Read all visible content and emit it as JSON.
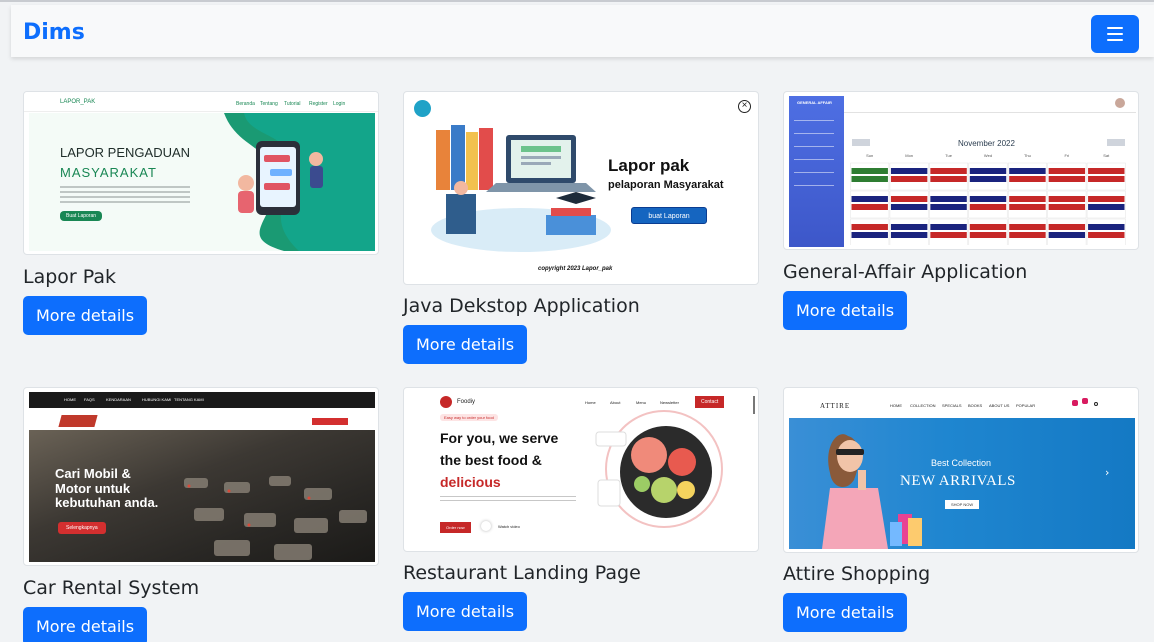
{
  "navbar": {
    "brand": "Dims",
    "menu_icon": "hamburger-icon"
  },
  "colors": {
    "primary": "#0d6efd",
    "page_bg": "#f1f3f5"
  },
  "projects": [
    {
      "title": "Lapor Pak",
      "button": "More details",
      "preview": {
        "logo": "LAPOR_PAK",
        "nav": [
          "Beranda",
          "Tentang",
          "Tutorial",
          "Register",
          "Login"
        ],
        "headline": "LAPOR PENGADUAN",
        "subheadline": "MASYARAKAT",
        "cta": "Buat Laporan"
      }
    },
    {
      "title": "Java Dekstop Application",
      "button": "More details",
      "preview": {
        "headline": "Lapor pak",
        "subheadline": "pelaporan Masyarakat",
        "cta": "buat Laporan",
        "footer": "copyright 2023 Lapor_pak"
      }
    },
    {
      "title": "General-Affair Application",
      "button": "More details",
      "preview": {
        "app_name": "GENERAL AFFAIR",
        "month": "November 2022",
        "days": [
          "Sun",
          "Mon",
          "Tue",
          "Wed",
          "Thu",
          "Fri",
          "Sat"
        ],
        "event": "Kebersihan meja ko"
      }
    },
    {
      "title": "Car Rental System",
      "button": "More details",
      "preview": {
        "nav": [
          "HOME",
          "FAQS",
          "KENDARAAN",
          "HUBUNGI KAMI",
          "TENTANG KAMI"
        ],
        "headline_1": "Cari Mobil &",
        "headline_2": "Motor untuk",
        "headline_3": "kebutuhan anda.",
        "cta": "Selengkapnya"
      }
    },
    {
      "title": "Restaurant Landing Page",
      "button": "More details",
      "preview": {
        "logo": "Foodiy",
        "nav": [
          "Home",
          "About",
          "Menu",
          "Newsletter"
        ],
        "contact": "Contact",
        "tagline": "Easy way to order your food",
        "headline_1": "For you, we serve",
        "headline_2": "the best food &",
        "headline_3": "delicious",
        "order": "Order now",
        "watch": "Watch video"
      }
    },
    {
      "title": "Attire Shopping",
      "button": "More details",
      "preview": {
        "logo": "ATTIRE",
        "nav": [
          "HOME",
          "COLLECTION",
          "SPECIALS",
          "BOOKS",
          "ABOUT US",
          "POPULAR"
        ],
        "kicker": "Best Collection",
        "headline": "NEW ARRIVALS",
        "cta": "SHOP NOW"
      }
    }
  ]
}
